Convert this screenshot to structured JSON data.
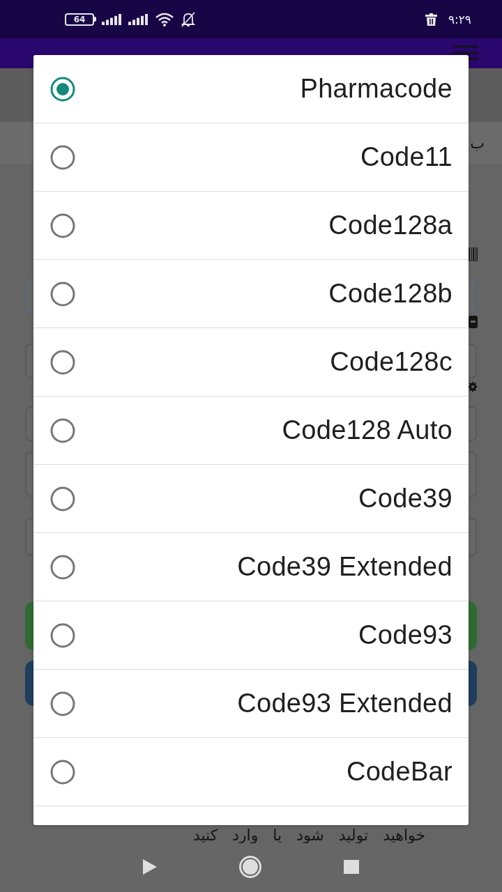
{
  "status_bar": {
    "battery": "64",
    "time": "۹:۲۹"
  },
  "background": {
    "banner_text": "ب",
    "footer_text": "خواهید تولید شود یا وارد کنید"
  },
  "dialog": {
    "options": [
      {
        "label": "Pharmacode",
        "selected": true
      },
      {
        "label": "Code11",
        "selected": false
      },
      {
        "label": "Code128a",
        "selected": false
      },
      {
        "label": "Code128b",
        "selected": false
      },
      {
        "label": "Code128c",
        "selected": false
      },
      {
        "label": "Code128 Auto",
        "selected": false
      },
      {
        "label": "Code39",
        "selected": false
      },
      {
        "label": "Code39 Extended",
        "selected": false
      },
      {
        "label": "Code93",
        "selected": false
      },
      {
        "label": "Code93 Extended",
        "selected": false
      },
      {
        "label": "CodeBar",
        "selected": false
      }
    ]
  }
}
